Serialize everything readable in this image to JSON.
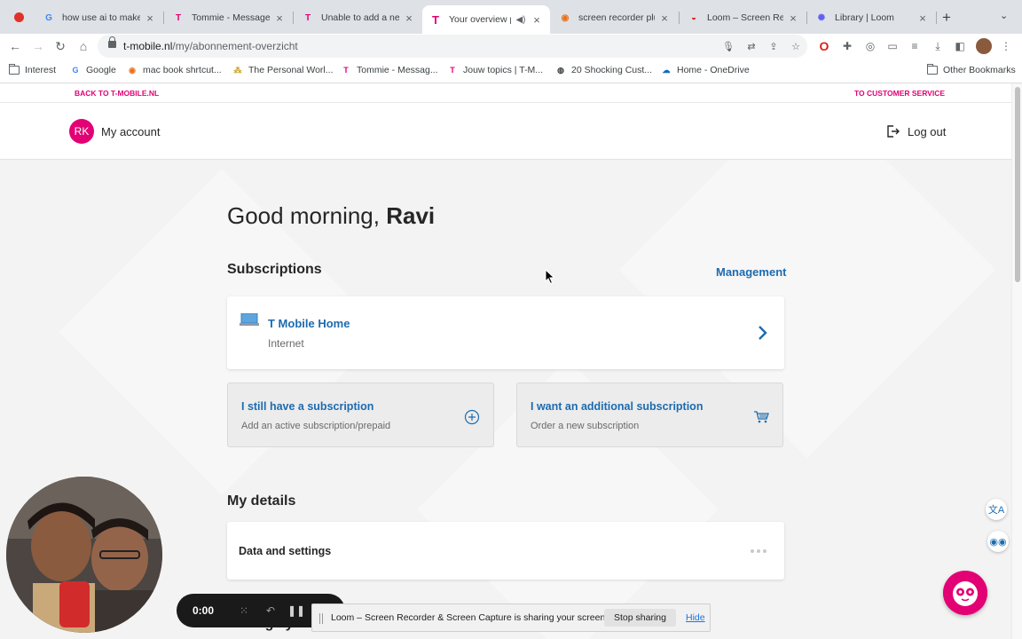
{
  "browser": {
    "tabs": [
      {
        "title": "how use ai to make m",
        "icon": "google-icon"
      },
      {
        "title": "Tommie - Messages",
        "icon": "tmobile-icon"
      },
      {
        "title": "Unable to add a new",
        "icon": "tmobile-icon"
      },
      {
        "title": "Your overview p",
        "icon": "tmobile-icon",
        "active": true
      },
      {
        "title": "screen recorder plug",
        "icon": "opera-icon"
      },
      {
        "title": "Loom – Screen Reco",
        "icon": "chrome-store-icon"
      },
      {
        "title": "Library | Loom",
        "icon": "loom-icon"
      }
    ],
    "url_host": "t-mobile.nl",
    "url_path": "/my/abonnement-overzicht",
    "bookmarks": [
      "Interest",
      "Google",
      "mac book shrtcut...",
      "The Personal Worl...",
      "Tommie - Messag...",
      "Jouw topics | T-M...",
      "20 Shocking Cust...",
      "Home - OneDrive"
    ],
    "other_bookmarks": "Other Bookmarks"
  },
  "page": {
    "top_left_link": "BACK TO T-MOBILE.NL",
    "top_right_link": "TO CUSTOMER SERVICE",
    "avatar_initials": "RK",
    "account_label": "My account",
    "logout_label": "Log out",
    "greeting_prefix": "Good morning, ",
    "greeting_name": "Ravi",
    "subscriptions_title": "Subscriptions",
    "management_link": "Management",
    "subscription": {
      "name": "T Mobile Home",
      "type": "Internet"
    },
    "actions": [
      {
        "title": "I still have a subscription",
        "subtitle": "Add an active subscription/prepaid",
        "icon": "plus-circle-icon"
      },
      {
        "title": "I want an additional subscription",
        "subtitle": "Order a new subscription",
        "icon": "cart-icon"
      }
    ],
    "details_title": "My details",
    "details_card": "Data and settings",
    "next_section_peek": "Arrange your"
  },
  "loom": {
    "timer": "0:00",
    "share_message": "Loom – Screen Recorder & Screen Capture is sharing your screen.",
    "stop_label": "Stop sharing",
    "hide_label": "Hide"
  },
  "colors": {
    "brand_magenta": "#e20074",
    "link_blue": "#1c6bb0"
  }
}
